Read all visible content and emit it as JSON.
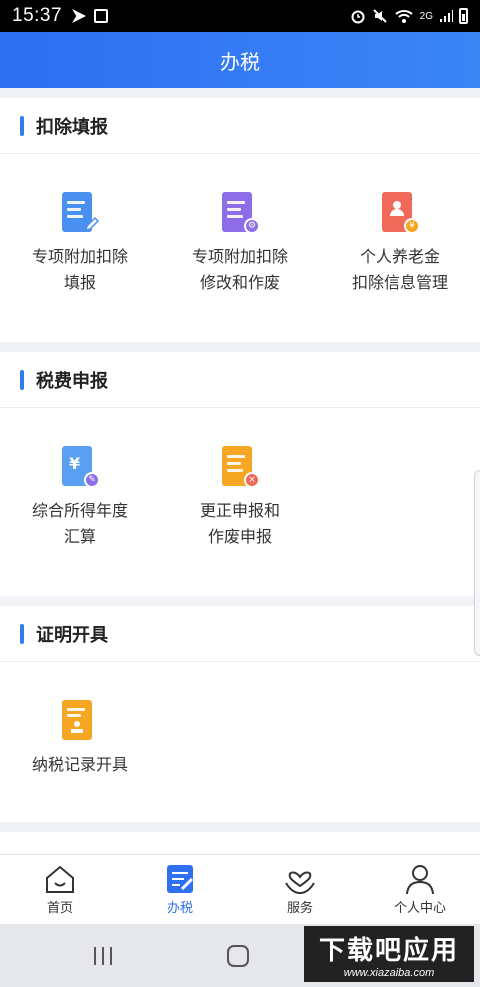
{
  "status_bar": {
    "time": "15:37",
    "network": "2G"
  },
  "app_bar": {
    "title": "办税"
  },
  "sections": [
    {
      "title": "扣除填报",
      "items": [
        {
          "line1": "专项附加扣除",
          "line2": "填报",
          "icon": "deduction-fill-icon",
          "color": "#4a90f0"
        },
        {
          "line1": "专项附加扣除",
          "line2": "修改和作废",
          "icon": "deduction-edit-icon",
          "color": "#8e6ee8"
        },
        {
          "line1": "个人养老金",
          "line2": "扣除信息管理",
          "icon": "pension-icon",
          "color": "#f06a5a"
        }
      ]
    },
    {
      "title": "税费申报",
      "items": [
        {
          "line1": "综合所得年度",
          "line2": "汇算",
          "icon": "annual-settlement-icon",
          "color": "#5aa0f2"
        },
        {
          "line1": "更正申报和",
          "line2": "作废申报",
          "icon": "correction-icon",
          "color": "#f5a623"
        }
      ]
    },
    {
      "title": "证明开具",
      "items": [
        {
          "line1": "纳税记录开具",
          "line2": "",
          "icon": "tax-record-icon",
          "color": "#f5a623"
        }
      ]
    }
  ],
  "bottom_nav": [
    {
      "label": "首页",
      "icon": "home-icon",
      "active": false
    },
    {
      "label": "办税",
      "icon": "tax-icon",
      "active": true
    },
    {
      "label": "服务",
      "icon": "service-icon",
      "active": false
    },
    {
      "label": "个人中心",
      "icon": "profile-icon",
      "active": false
    }
  ],
  "watermark": {
    "text": "下载吧应用",
    "url": "www.xiazaiba.com"
  },
  "colors": {
    "accent": "#2f6ff2",
    "section_bar": "#2f7bf0"
  }
}
